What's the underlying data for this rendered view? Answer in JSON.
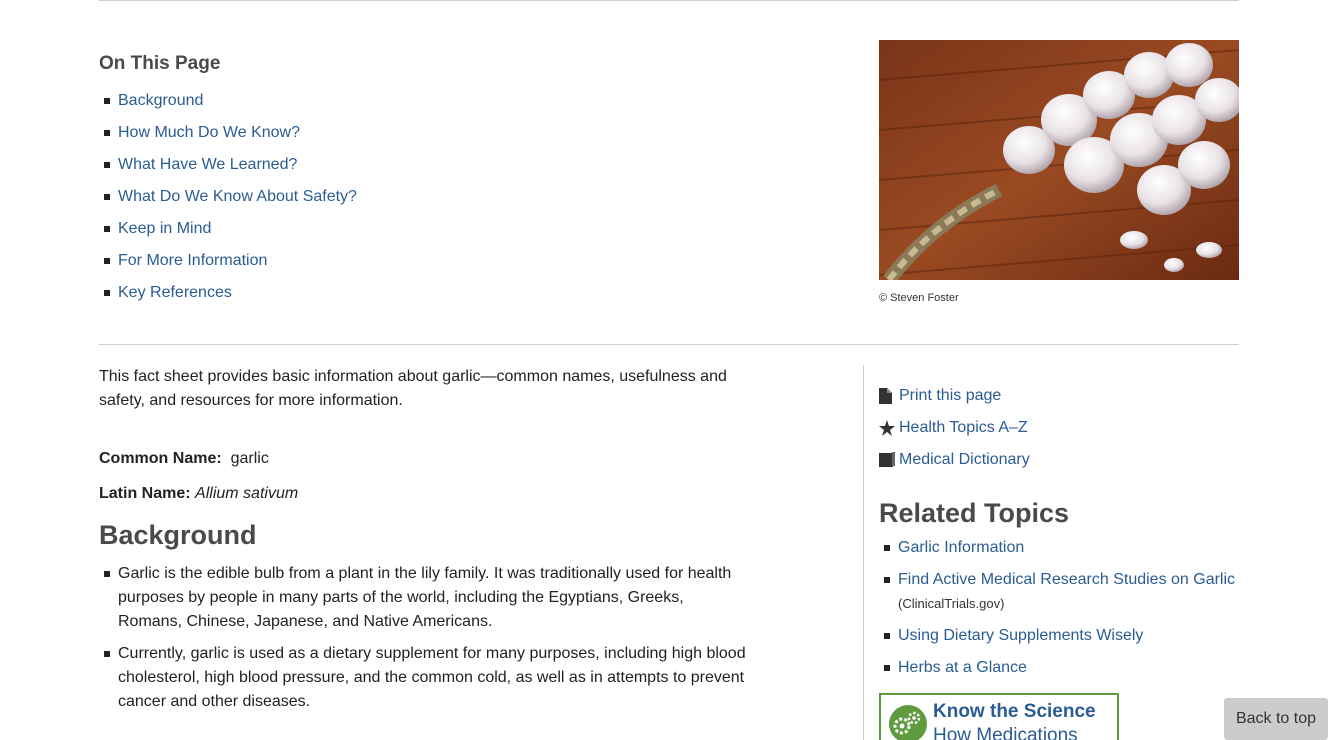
{
  "on_this_page": {
    "title": "On This Page",
    "items": [
      "Background",
      "How Much Do We Know?",
      "What Have We Learned?",
      "What Do We Know About Safety?",
      "Keep in Mind",
      "For More Information",
      "Key References"
    ]
  },
  "photo": {
    "caption": "© Steven Foster"
  },
  "intro": "This fact sheet provides basic information about garlic—common names, usefulness and safety, and resources for more information.",
  "common_name": {
    "label": "Common Name:",
    "value": "garlic"
  },
  "latin_name": {
    "label": "Latin Name:",
    "value": "Allium sativum"
  },
  "background": {
    "heading": "Background",
    "items": [
      "Garlic is the edible bulb from a plant in the lily family. It was traditionally used for health purposes by people in many parts of the world, including the Egyptians, Greeks, Romans, Chinese, Japanese, and Native Americans.",
      "Currently, garlic is used as a dietary supplement for many purposes, including high blood cholesterol, high blood pressure, and the common cold, as well as in attempts to prevent cancer and other diseases."
    ]
  },
  "tools": {
    "print": "Print this page",
    "health_topics": "Health Topics A–Z",
    "dictionary": "Medical Dictionary"
  },
  "related": {
    "heading": "Related Topics",
    "item1": "Garlic Information",
    "item2": "Find Active Medical Research Studies on Garlic",
    "item2_note": "(ClinicalTrials.gov)",
    "item3": "Using Dietary Supplements Wisely",
    "item4": "Herbs at a Glance"
  },
  "banner": {
    "title": "Know the Science",
    "subtitle": "How Medications"
  },
  "back_to_top": "Back to top",
  "colors": {
    "link": "#2a5c94",
    "heading": "#4a4a4a",
    "banner_green": "#5e9a3e"
  }
}
